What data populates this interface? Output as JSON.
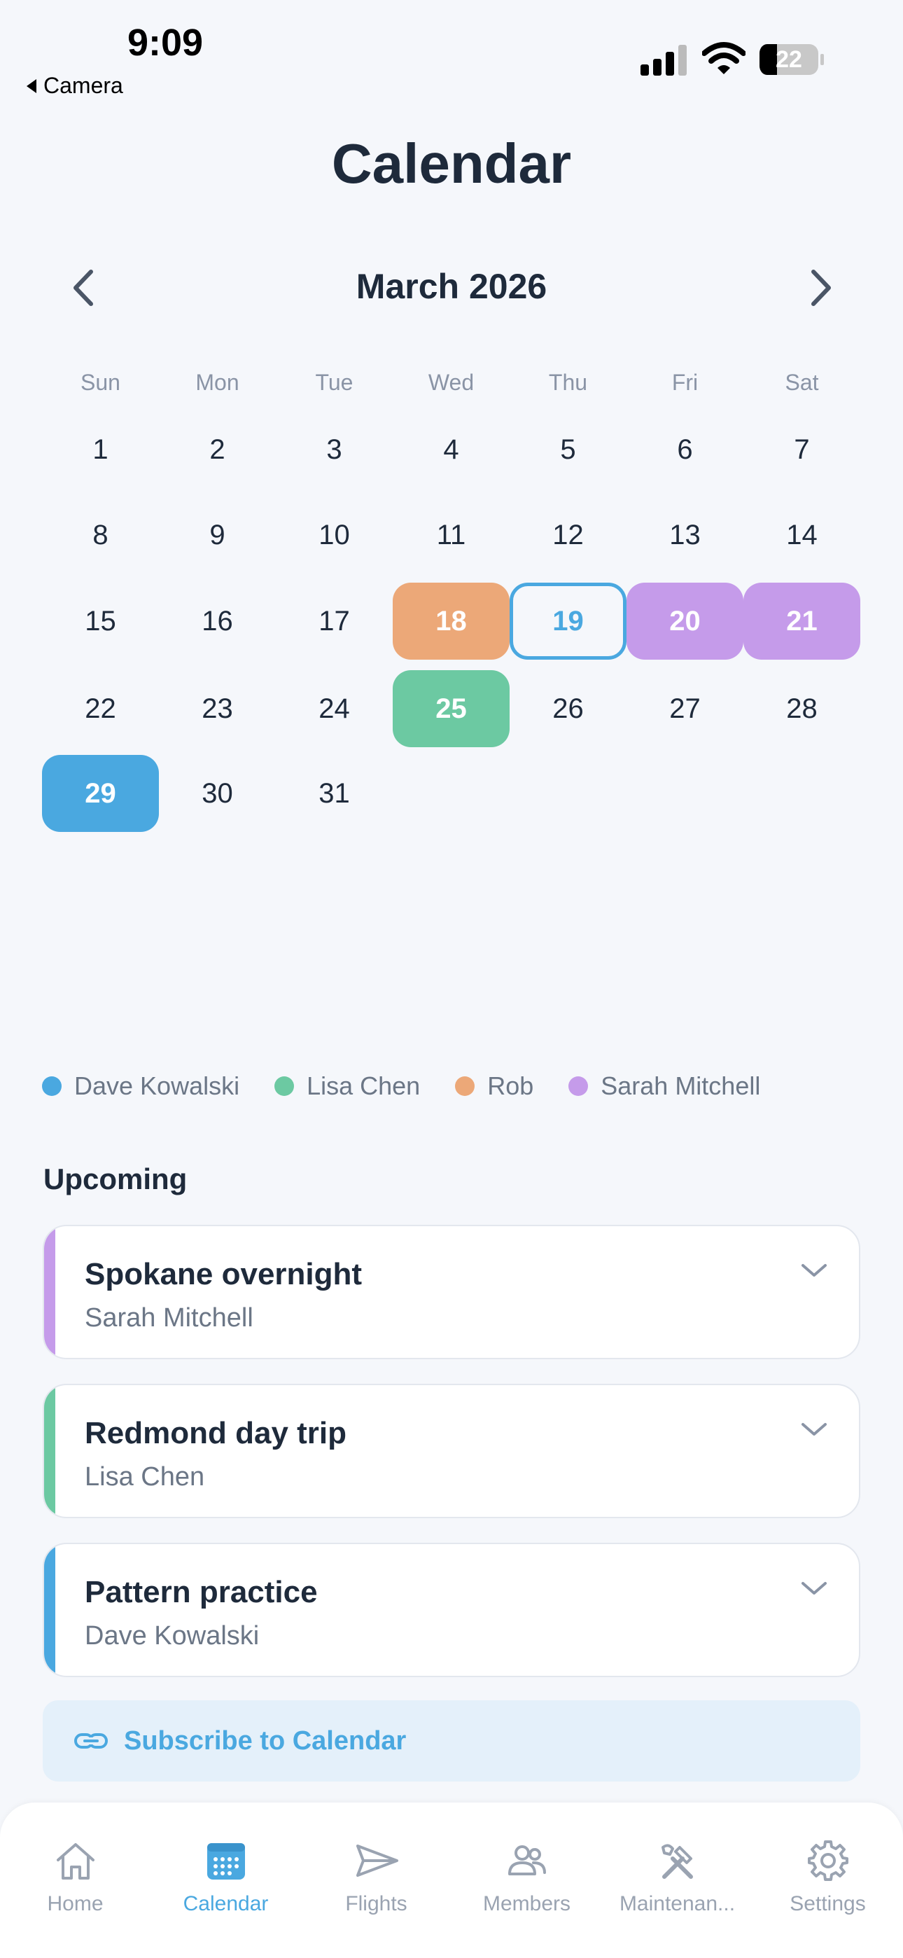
{
  "status_bar": {
    "time": "9:09",
    "back_label": "Camera",
    "battery": "22"
  },
  "page": {
    "title": "Calendar"
  },
  "calendar": {
    "month_label": "March 2026",
    "weekdays": [
      "Sun",
      "Mon",
      "Tue",
      "Wed",
      "Thu",
      "Fri",
      "Sat"
    ],
    "days": [
      "1",
      "2",
      "3",
      "4",
      "5",
      "6",
      "7",
      "8",
      "9",
      "10",
      "11",
      "12",
      "13",
      "14",
      "15",
      "16",
      "17",
      "18",
      "19",
      "20",
      "21",
      "22",
      "23",
      "24",
      "25",
      "26",
      "27",
      "28",
      "29",
      "30",
      "31"
    ],
    "today": "19",
    "event_days": [
      {
        "day": "18",
        "member": "Rob",
        "color": "#eca878"
      },
      {
        "day": "20",
        "member": "Sarah Mitchell",
        "color": "#c59bea"
      },
      {
        "day": "21",
        "member": "Sarah Mitchell",
        "color": "#c59bea"
      },
      {
        "day": "25",
        "member": "Lisa Chen",
        "color": "#6cc9a2"
      },
      {
        "day": "29",
        "member": "Dave Kowalski",
        "color": "#4aa8e0"
      }
    ]
  },
  "legend": [
    {
      "name": "Dave Kowalski",
      "color": "#4aa8e0"
    },
    {
      "name": "Lisa Chen",
      "color": "#6cc9a2"
    },
    {
      "name": "Rob",
      "color": "#eca878"
    },
    {
      "name": "Sarah Mitchell",
      "color": "#c59bea"
    }
  ],
  "upcoming": {
    "heading": "Upcoming",
    "items": [
      {
        "title": "Spokane overnight",
        "member": "Sarah Mitchell",
        "color": "#c59bea"
      },
      {
        "title": "Redmond day trip",
        "member": "Lisa Chen",
        "color": "#6cc9a2"
      },
      {
        "title": "Pattern practice",
        "member": "Dave Kowalski",
        "color": "#4aa8e0"
      }
    ]
  },
  "subscribe": {
    "label": "Subscribe to Calendar"
  },
  "tabs": [
    {
      "label": "Home",
      "icon": "home-icon"
    },
    {
      "label": "Calendar",
      "icon": "calendar-icon",
      "active": true
    },
    {
      "label": "Flights",
      "icon": "paper-plane-icon"
    },
    {
      "label": "Members",
      "icon": "members-icon"
    },
    {
      "label": "Maintenan...",
      "icon": "tools-icon"
    },
    {
      "label": "Settings",
      "icon": "gear-icon"
    }
  ],
  "colors": {
    "accent": "#4aa8e0",
    "title": "#1e2a3b",
    "muted": "#6b7686"
  }
}
